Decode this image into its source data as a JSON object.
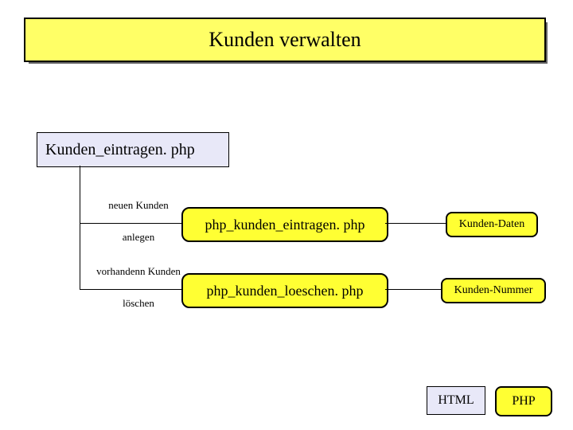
{
  "title": "Kunden verwalten",
  "entry_box": "Kunden_eintragen. php",
  "branch1": {
    "edge_top": "neuen Kunden",
    "edge_bottom": "anlegen",
    "box": "php_kunden_eintragen. php",
    "tag": "Kunden-Daten"
  },
  "branch2": {
    "edge_top": "vorhandenn Kunden",
    "edge_bottom": "löschen",
    "box": "php_kunden_loeschen. php",
    "tag": "Kunden-Nummer"
  },
  "legend": {
    "lavender": "HTML",
    "yellow": "PHP"
  }
}
